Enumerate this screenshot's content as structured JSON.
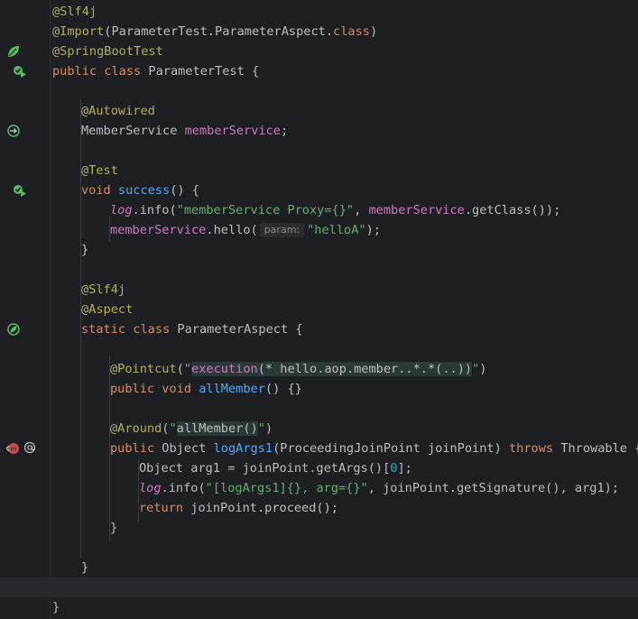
{
  "editor": {
    "colors": {
      "background": "#1e1f22",
      "annotation": "#b3ae60",
      "keyword": "#cf8e6d",
      "string": "#6aab73",
      "field": "#c77dbb",
      "function": "#56a8f5",
      "number": "#2aacb8"
    },
    "gutter_icons": [
      {
        "line": 3,
        "icon": "spring-leaf-icon"
      },
      {
        "line": 4,
        "icon": "run-test-icon"
      },
      {
        "line": 7,
        "icon": "bean-navigation-icon"
      },
      {
        "line": 10,
        "icon": "run-test-icon"
      },
      {
        "line": 17,
        "icon": "spring-bean-icon"
      },
      {
        "line": 23,
        "icon": "aop-advice-icon"
      },
      {
        "line": 23,
        "icon": "at-annotation-icon"
      }
    ],
    "lines": {
      "l1_ann": "@Slf4j",
      "l2_ann": "@Import",
      "l2_a": "(ParameterTest.ParameterAspect.",
      "l2_kw": "class",
      "l2_b": ")",
      "l3_ann": "@SpringBootTest",
      "l4_kw": "public class ",
      "l4_b": "ParameterTest {",
      "l6_ann": "@Autowired",
      "l7_a": "MemberService ",
      "l7_fld": "memberService",
      "l7_b": ";",
      "l9_ann": "@Test",
      "l10_kw": "void ",
      "l10_fn": "success",
      "l10_b": "() {",
      "l11_log": "log",
      "l11_a": ".info(",
      "l11_str": "\"memberService Proxy={}\"",
      "l11_b": ", ",
      "l11_fld": "memberService",
      "l11_c": ".getClass());",
      "l12_fld": "memberService",
      "l12_a": ".hello(",
      "l12_hint": "param:",
      "l12_str": "\"helloA\"",
      "l12_b": ");",
      "l13": "}",
      "l15_ann": "@Slf4j",
      "l16_ann": "@Aspect",
      "l17_kw": "static class ",
      "l17_b": "ParameterAspect {",
      "l19_ann": "@Pointcut",
      "l19_a": "(",
      "l19_q1": "\"",
      "l19_exec": "execution",
      "l19_expr": "(* hello.aop.member..*.*(..))",
      "l19_q2": "\"",
      "l19_b": ")",
      "l20_kw": "public void ",
      "l20_fn": "allMember",
      "l20_b": "() {}",
      "l22_ann": "@Around",
      "l22_a": "(",
      "l22_q1": "\"",
      "l22_ref": "allMember()",
      "l22_q2": "\"",
      "l22_b": ")",
      "l23_kw": "public ",
      "l23_a": "Object ",
      "l23_fn": "logArgs1",
      "l23_b": "(ProceedingJoinPoint joinPoint) ",
      "l23_kw2": "throws ",
      "l23_c": "Throwable {",
      "l24_a": "Object arg1 = joinPoint.getArgs()[",
      "l24_num": "0",
      "l24_b": "];",
      "l25_log": "log",
      "l25_a": ".info(",
      "l25_str": "\"[logArgs1]{}, arg={}\"",
      "l25_b": ", joinPoint.getSignature(), arg1);",
      "l26_kw": "return ",
      "l26_a": "joinPoint.proceed();",
      "l27": "}",
      "l29": "}",
      "l31": "}"
    }
  }
}
